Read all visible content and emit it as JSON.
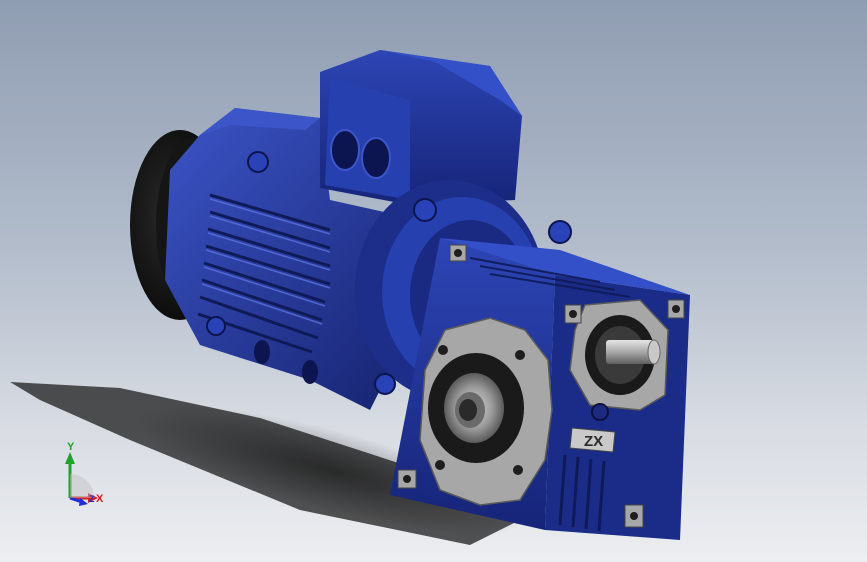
{
  "viewport": {
    "background_top": "#8f9db2",
    "background_bottom": "#eceef1"
  },
  "model": {
    "body_color": "#22369a",
    "body_dark": "#14206a",
    "body_light": "#3c55c8",
    "machined_color": "#a7a7a7",
    "nameplate_text": "ZX"
  },
  "triad": {
    "y_label": "Y",
    "x_label": "X",
    "z_label": "Z",
    "y_color": "#1fa32a",
    "x_color": "#d42020",
    "z_color": "#1f2fd4"
  }
}
